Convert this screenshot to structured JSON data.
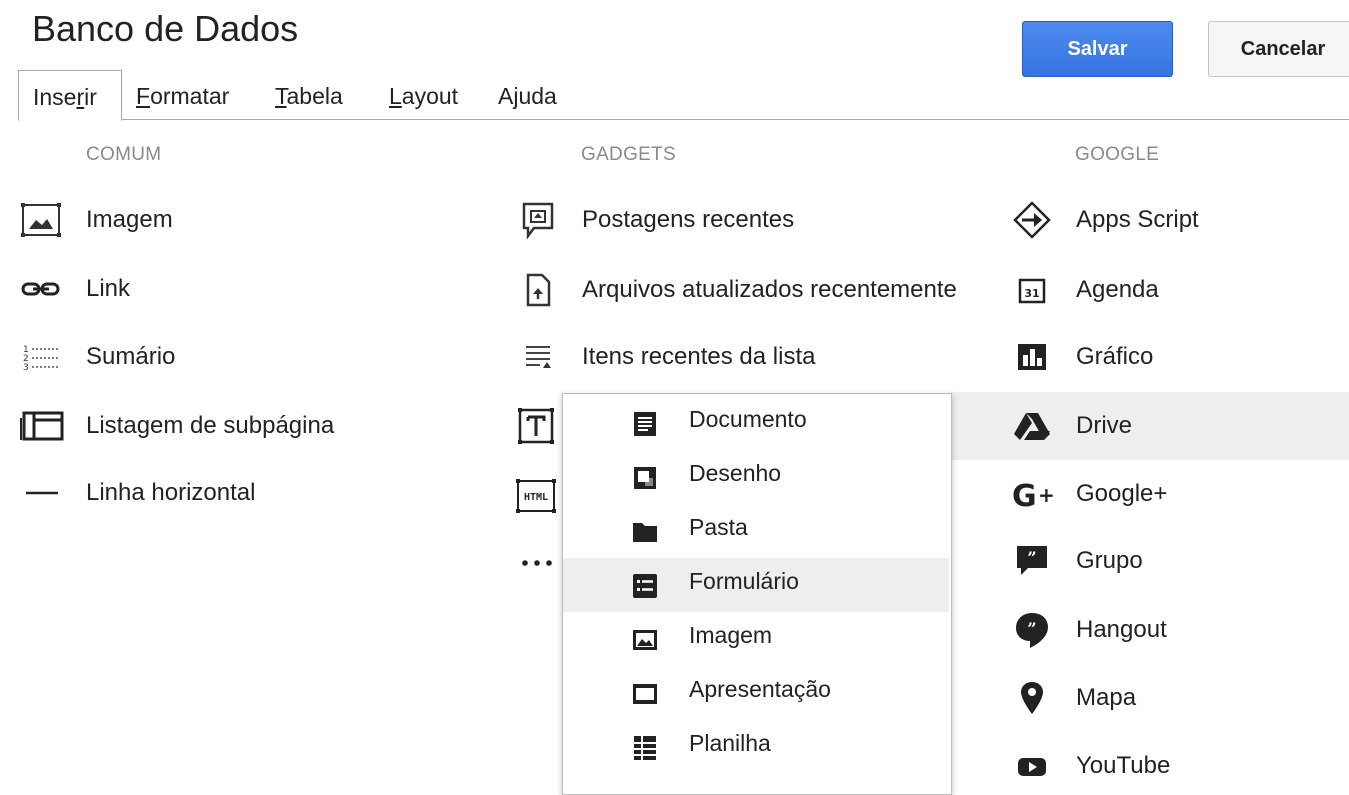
{
  "header": {
    "title": "Banco de Dados",
    "save_label": "Salvar",
    "cancel_label": "Cancelar"
  },
  "menu": [
    {
      "label": "Inserir",
      "pre": "Inse",
      "ul": "r",
      "post": "ir",
      "active": true
    },
    {
      "label": "Formatar",
      "pre": "",
      "ul": "F",
      "post": "ormatar"
    },
    {
      "label": "Tabela",
      "pre": "",
      "ul": "T",
      "post": "abela"
    },
    {
      "label": "Layout",
      "pre": "",
      "ul": "L",
      "post": "ayout"
    },
    {
      "label": "Ajuda",
      "pre": "Ajuda",
      "ul": "",
      "post": ""
    }
  ],
  "sections": {
    "comum": "COMUM",
    "gadgets": "GADGETS",
    "google": "GOOGLE"
  },
  "comum": [
    {
      "label": "Imagem",
      "icon": "image-icon"
    },
    {
      "label": "Link",
      "icon": "link-icon"
    },
    {
      "label": "Sumário",
      "icon": "table-of-contents-icon"
    },
    {
      "label": "Listagem de subpágina",
      "icon": "subpage-listing-icon"
    },
    {
      "label": "Linha horizontal",
      "icon": "horizontal-line-icon"
    }
  ],
  "gadgets": [
    {
      "label": "Postagens recentes",
      "icon": "recent-posts-icon"
    },
    {
      "label": "Arquivos atualizados recentemente",
      "icon": "recent-files-icon"
    },
    {
      "label": "Itens recentes da lista",
      "icon": "recent-list-items-icon"
    },
    {
      "label": "",
      "icon": "text-box-icon"
    },
    {
      "label": "",
      "icon": "html-box-icon"
    },
    {
      "label": "",
      "icon": "more-icon"
    }
  ],
  "google": [
    {
      "label": "Apps Script",
      "icon": "apps-script-icon"
    },
    {
      "label": "Agenda",
      "icon": "calendar-icon"
    },
    {
      "label": "Gráfico",
      "icon": "chart-icon"
    },
    {
      "label": "Drive",
      "icon": "drive-icon"
    },
    {
      "label": "Google+",
      "icon": "google-plus-icon"
    },
    {
      "label": "Grupo",
      "icon": "group-icon"
    },
    {
      "label": "Hangout",
      "icon": "hangout-icon"
    },
    {
      "label": "Mapa",
      "icon": "map-icon"
    },
    {
      "label": "YouTube",
      "icon": "youtube-icon"
    }
  ],
  "drive_menu": [
    {
      "label": "Documento",
      "icon": "document-icon"
    },
    {
      "label": "Desenho",
      "icon": "drawing-icon"
    },
    {
      "label": "Pasta",
      "icon": "folder-icon"
    },
    {
      "label": "Formulário",
      "icon": "form-icon"
    },
    {
      "label": "Imagem",
      "icon": "image-icon"
    },
    {
      "label": "Apresentação",
      "icon": "presentation-icon"
    },
    {
      "label": "Planilha",
      "icon": "spreadsheet-icon"
    }
  ],
  "colors": {
    "primary": "#3b7ce8",
    "highlight": "#eeeeee",
    "section_label": "#8a8a8a"
  }
}
